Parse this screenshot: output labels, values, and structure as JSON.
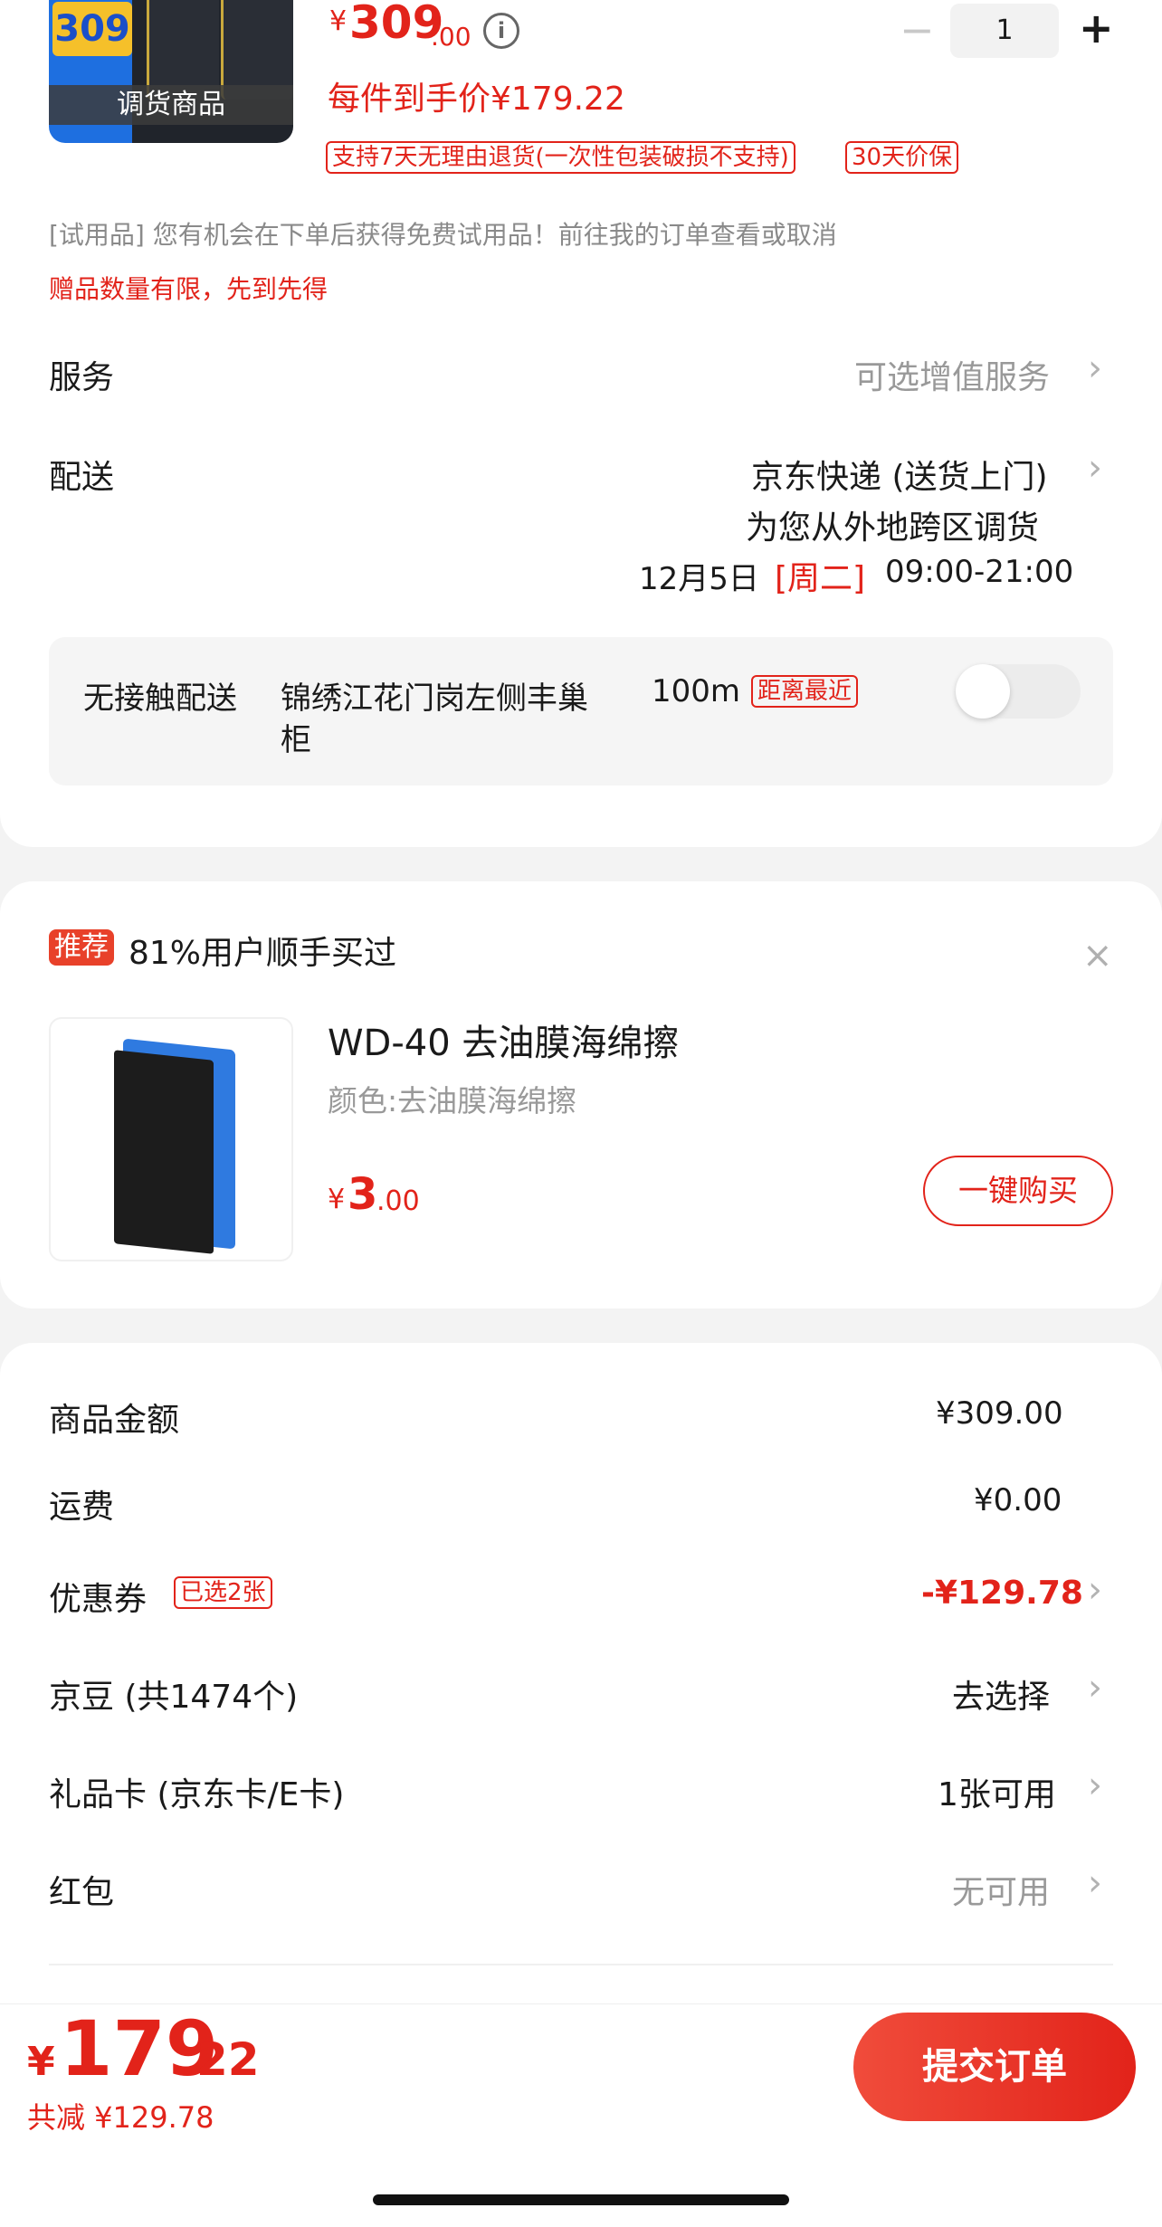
{
  "product": {
    "image_label": "调货商品",
    "image_badge": "309",
    "price_symbol": "¥",
    "price_int": "309",
    "price_dec": ".00",
    "per_item_price": "每件到手价¥179.22",
    "qty": "1",
    "return_tag": "支持7天无理由退货(一次性包装破损不支持)",
    "price_protect_tag": "30天价保",
    "trial_note": "[试用品] 您有机会在下单后获得免费试用品！前往我的订单查看或取消",
    "gift_note": "赠品数量有限，先到先得"
  },
  "service": {
    "label": "服务",
    "value": "可选增值服务"
  },
  "delivery": {
    "label": "配送",
    "method": "京东快递 (送货上门)",
    "note": "为您从外地跨区调货",
    "date": "12月5日",
    "weekday": "[周二]",
    "time": "09:00-21:00"
  },
  "contactless": {
    "label": "无接触配送",
    "location_line1": "锦绣江花门岗左侧丰巢",
    "distance": "100m",
    "location_line2": "柜",
    "tag": "距离最近",
    "enabled": false
  },
  "recommend": {
    "badge": "推荐",
    "headline": "81%用户顺手买过",
    "item_name": "WD-40 去油膜海绵擦",
    "item_spec": "颜色:去油膜海绵擦",
    "price_symbol": "¥",
    "price_int": "3",
    "price_dec": ".00",
    "buy_label": "一键购买"
  },
  "summary": {
    "goods_amount_label": "商品金额",
    "goods_amount": "¥309.00",
    "shipping_label": "运费",
    "shipping": "¥0.00",
    "coupon_label": "优惠券",
    "coupon_tag": "已选2张",
    "coupon_value": "-¥129.78",
    "jingdou_label": "京豆 (共1474个)",
    "jingdou_value": "去选择",
    "giftcard_label": "礼品卡 (京东卡/E卡)",
    "giftcard_value": "1张可用",
    "redpacket_label": "红包",
    "redpacket_value": "无可用"
  },
  "footer": {
    "currency": "¥",
    "total_int": "179",
    "total_dec": ".22",
    "discount_note": "共减 ¥129.78",
    "submit_label": "提交订单"
  },
  "colors": {
    "accent": "#e2231a",
    "page_bg": "#f3f3f3"
  }
}
